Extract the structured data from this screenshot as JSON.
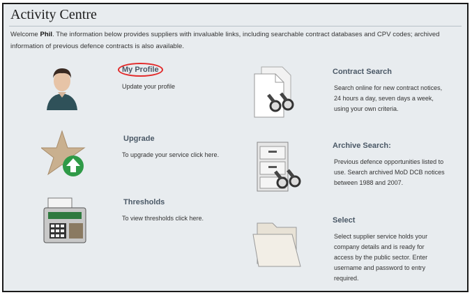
{
  "page": {
    "title": "Activity Centre",
    "intro_greeting": "Welcome ",
    "intro_user": "Phil",
    "intro_text": ". The information below provides suppliers with invaluable links, including searchable contract databases and CPV codes; archived information of previous defence contracts is also available."
  },
  "items": {
    "profile": {
      "title": "My Profile",
      "desc": "Update your profile",
      "icon": "user-avatar-icon"
    },
    "upgrade": {
      "title": "Upgrade",
      "desc": "To upgrade your service click here.",
      "icon": "star-upgrade-icon"
    },
    "thresholds": {
      "title": "Thresholds",
      "desc": "To view thresholds click here.",
      "icon": "cash-register-icon"
    },
    "contract": {
      "title": "Contract Search",
      "desc": "Search online for new contract notices, 24 hours a day, seven days a week, using your own criteria.",
      "icon": "document-binoculars-icon"
    },
    "archive": {
      "title": "Archive Search:",
      "desc": "Previous defence opportunities listed to use. Search archived MoD DCB notices between 1988 and 2007.",
      "icon": "filing-cabinet-binoculars-icon"
    },
    "select": {
      "title": "Select",
      "desc": "Select supplier service holds your company details and is ready for access by the public sector. Enter username and password to entry required.",
      "icon": "open-folder-icon"
    }
  },
  "colors": {
    "panel_bg": "#e8ecef",
    "border": "#1a1a1a",
    "link": "#4a5866",
    "highlight": "#e22b2b"
  }
}
